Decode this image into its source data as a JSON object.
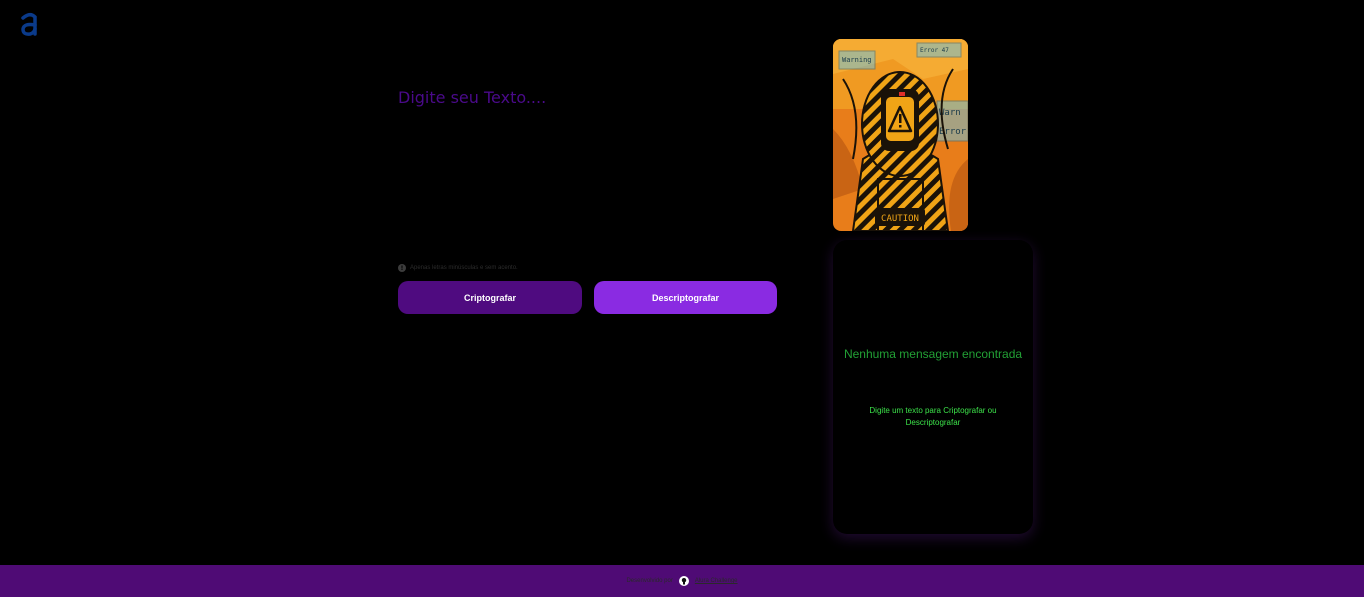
{
  "logo": {
    "letter": "a",
    "color": "#0a3a8a"
  },
  "editor": {
    "placeholder": "Digite seu Texto....",
    "text_color": "#4a0a8a"
  },
  "hint": {
    "icon": "info-icon",
    "text": "Apenas letras minúsculas e sem acento."
  },
  "buttons": {
    "encrypt_label": "Criptografar",
    "decrypt_label": "Descriptografar",
    "encrypt_color": "#4f0b80",
    "decrypt_color": "#8a2be2"
  },
  "illustration": {
    "caption": "CAUTION",
    "labels": [
      "Warning",
      "Error 47",
      "Warn",
      "Error"
    ]
  },
  "output_panel": {
    "title": "Nenhuma mensagem encontrada",
    "subtitle": "Digite um texto para Criptografar ou Descriptografar",
    "title_color": "#22a035",
    "subtitle_color": "#3ce34a"
  },
  "footer": {
    "text": "Desenvolvido por",
    "icon": "github-icon",
    "link_text": "Alura Challenge",
    "background": "#4f0b75"
  }
}
